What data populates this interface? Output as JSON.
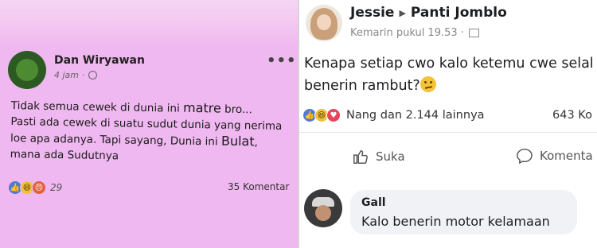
{
  "left_post": {
    "author": "Dan Wiryawan",
    "time": "4 jam",
    "more": "•••",
    "text_part1": "Tidak semua cewek di dunia ini ",
    "text_big1": "matre",
    "text_part2": " bro...",
    "text_line2": "Pasti ada cewek di suatu sudut dunia yang nerima loe apa adanya. Tapi sayang, Dunia ini ",
    "text_big2": "Bulat",
    "text_line3": ", mana ada Sudutnya",
    "reaction_count": "29",
    "comments": "35 Komentar",
    "reactions": [
      "like-reaction-icon",
      "haha-reaction-icon",
      "angry-reaction-icon"
    ]
  },
  "right_post": {
    "author": "Jessie",
    "group": "Panti Jomblo",
    "time": "Kemarin pukul 19.53 ·",
    "text_line1": "Kenapa setiap cwo kalo ketemu cwe selal",
    "text_line2": "benerin rambut?",
    "reactions_text": "Nang dan 2.144 lainnya",
    "comments": "643 Ko",
    "like_label": "Suka",
    "comment_label": "Komenta",
    "reactions": [
      "like-reaction-icon",
      "haha-reaction-icon",
      "love-reaction-icon"
    ]
  },
  "comment": {
    "author": "Gall",
    "text": "Kalo benerin motor kelamaan"
  },
  "colors": {
    "left_bg": "#f0b8f0",
    "like_blue": "#4f7ad6",
    "bubble_bg": "#f0f2f5"
  }
}
